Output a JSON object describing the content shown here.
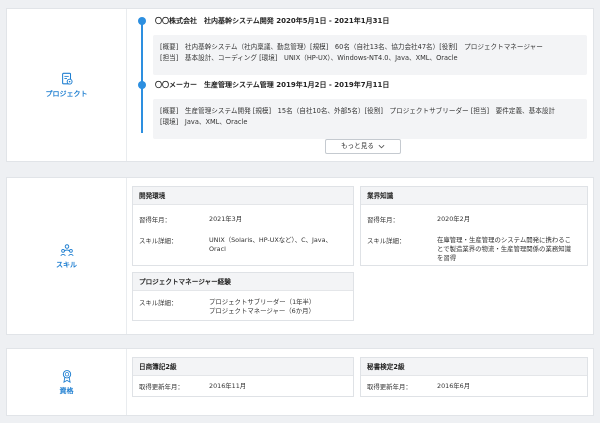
{
  "project": {
    "label": "プロジェクト",
    "items": [
      {
        "title": "〇〇株式会社　社内基幹システム開発 2020年5月1日 - 2021年1月31日",
        "line1": "[概要]　社内基幹システム（社内稟議、勤怠管理）[規模]　60名（自社13名、協力会社47名）[役割]　プロジェクトマネージャー",
        "line2": "[担当]　基本設計、コーディング [環境]　UNIX（HP-UX）、Windows-NT4.0、Java、XML、Oracle"
      },
      {
        "title": "〇〇メーカー　生産管理システム管理 2019年1月2日 - 2019年7月11日",
        "line1": "[概要]　生産管理システム開発 [規模]　15名（自社10名、外部5名）[役割]　プロジェクトサブリーダー [担当]　要件定義、基本設計",
        "line2": "[環境]　Java、XML、Oracle"
      }
    ],
    "more_label": "もっと見る"
  },
  "skill": {
    "label": "スキル",
    "dev_env": {
      "header": "開発環境",
      "k1": "習得年月：",
      "v1": "2021年3月",
      "k2": "スキル詳細：",
      "v2a": "UNIX（Solaris、HP-UXなど）、C、Java、",
      "v2b": "Oracl"
    },
    "business": {
      "header": "業界知識",
      "k1": "習得年月：",
      "v1": "2020年2月",
      "k2": "スキル詳細：",
      "v2a": "在庫管理・生産管理のシステム開発に携わるこ",
      "v2b": "とで製造業界の物流・生産管理関係の業務知識",
      "v2c": "を習得"
    },
    "pm": {
      "header": "プロジェクトマネージャー経験",
      "k1": "スキル詳細：",
      "v1a": "プロジェクトサブリーダー（1年半）",
      "v1b": "プロジェクトマネージャー（6か月）"
    }
  },
  "cert": {
    "label": "資格",
    "items": [
      {
        "header": "日商簿記2級",
        "k": "取得更新年月：",
        "v": "2016年11月"
      },
      {
        "header": "秘書検定2級",
        "k": "取得更新年月：",
        "v": "2016年6月"
      }
    ]
  },
  "colors": {
    "accent": "#2d8fe0"
  },
  "icons": {
    "project": "project-document-icon",
    "skill": "skill-people-icon",
    "cert": "certificate-badge-icon",
    "more": "chevron-down-icon"
  }
}
